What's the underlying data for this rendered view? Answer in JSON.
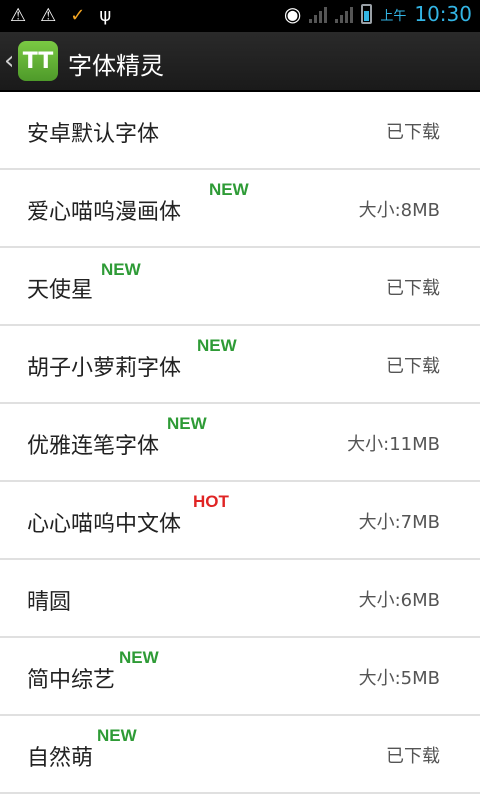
{
  "statusbar": {
    "time": "10:30",
    "ampm": "上午",
    "left_icons": [
      "warning-icon",
      "warning-icon",
      "download-done-icon",
      "usb-icon"
    ]
  },
  "actionbar": {
    "title": "字体精灵",
    "app_icon_text": "TT"
  },
  "fonts": [
    {
      "name": "安卓默认字体",
      "status": "已下载",
      "badge": ""
    },
    {
      "name": "爱心喵呜漫画体",
      "status": "大小:8MB",
      "badge": "NEW"
    },
    {
      "name": "天使星",
      "status": "已下载",
      "badge": "NEW"
    },
    {
      "name": "胡子小萝莉字体",
      "status": "已下载",
      "badge": "NEW"
    },
    {
      "name": "优雅连笔字体",
      "status": "大小:11MB",
      "badge": "NEW"
    },
    {
      "name": "心心喵呜中文体",
      "status": "大小:7MB",
      "badge": "HOT"
    },
    {
      "name": "晴圆",
      "status": "大小:6MB",
      "badge": ""
    },
    {
      "name": "简中综艺",
      "status": "大小:5MB",
      "badge": "NEW"
    },
    {
      "name": "自然萌",
      "status": "已下载",
      "badge": "NEW"
    }
  ],
  "colors": {
    "new": "#2e9b36",
    "hot": "#e02424",
    "accent": "#33b5e5"
  }
}
